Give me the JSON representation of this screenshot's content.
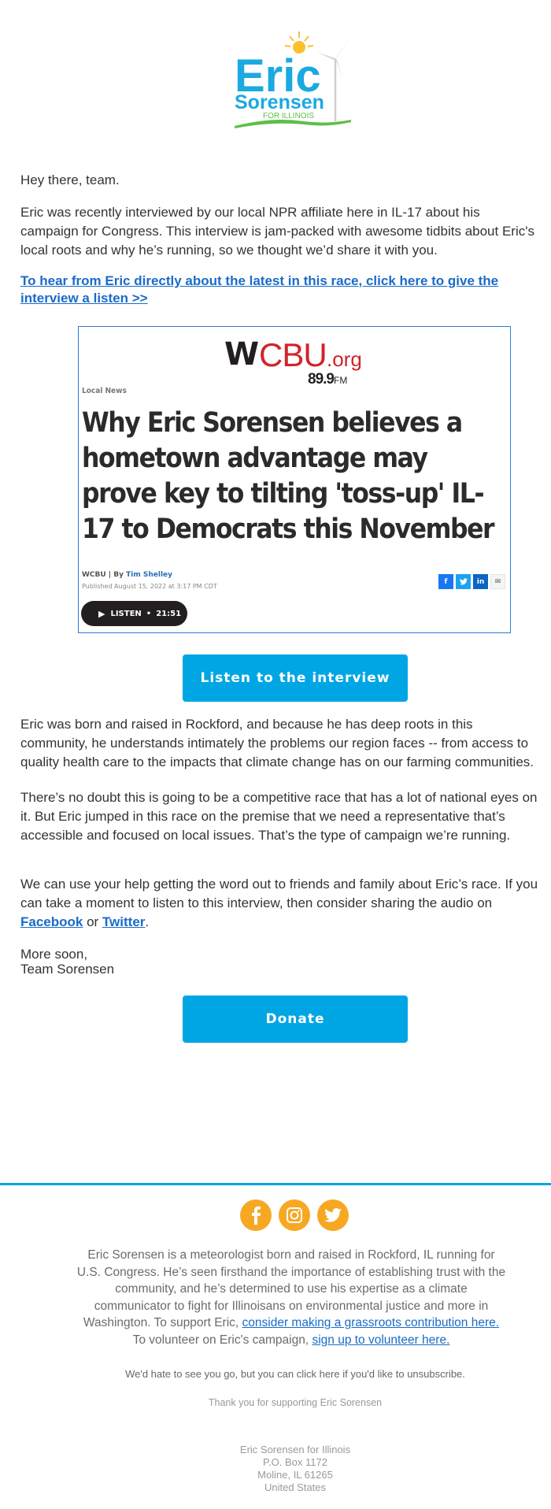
{
  "header": {
    "logo": {
      "name": "Eric",
      "surname": "Sorensen",
      "tagline": "FOR ILLINOIS"
    }
  },
  "body": {
    "greeting": "Hey there, team.",
    "para1_lines": [
      "Eric was recently interviewed by our local NPR affiliate here in IL-17 about his",
      "campaign for Congress. This interview is jam-packed with awesome tidbits about Eric's",
      "local roots and why he’s running, so we thought we’d share it with you."
    ],
    "cta_link": "To hear from Eric directly about the latest in this race, click here to give the interview a listen >> ",
    "news_card": {
      "station_w": "W",
      "station_cbu": "CBU",
      "station_org": ".org",
      "station_freq": "89.9",
      "station_fm": "FM",
      "section": "Local News",
      "headline": "Why Eric Sorensen believes a hometown advantage may prove key to tilting 'toss-up' IL-17 to Democrats this November",
      "byline_prefix": "WCBU | By ",
      "author": "Tim Shelley",
      "published": "Published August 15, 2022 at 3:17 PM CDT",
      "share": {
        "facebook": "f",
        "twitter": "t",
        "linkedin": "in",
        "email": "✉"
      },
      "listen_label": "LISTEN",
      "listen_sep": "•",
      "duration": "21:51"
    },
    "listen_button": "Listen to the interview",
    "para2_lines": [
      "Eric was born and raised in Rockford, and because he has deep roots in this",
      "community, he understands intimately the problems our region faces -- from access to",
      "quality health care to the impacts that climate change has on our farming communities."
    ],
    "para3_lines": [
      "There’s no doubt this is going to be a competitive race that has a lot of national eyes on",
      "it. But Eric jumped in this race on the premise that we need a representative that’s",
      "accessible and focused on local issues. That’s the type of campaign we’re running."
    ],
    "para4_lines": [
      "We can use your help getting the word out to friends and family about Eric’s race. If you",
      "can take a moment to listen to this interview, then consider sharing the audio on"
    ],
    "para4_facebook": "Facebook",
    "para4_or": " or ",
    "para4_twitter": "Twitter",
    "para4_end": ".",
    "closing": "More soon,",
    "signature": "Team Sorensen",
    "donate_button": "Donate"
  },
  "footer": {
    "social": [
      "facebook",
      "instagram",
      "twitter"
    ],
    "bio_lines": [
      "Eric Sorensen is a meteorologist born and raised in Rockford, IL running for",
      "U.S. Congress. He’s seen firsthand the importance of establishing trust with the",
      "community, and he’s determined to use his expertise as a climate",
      "communicator to fight for Illinoisans on environmental justice and more in"
    ],
    "bio_support_prefix": "Washington. To support Eric, ",
    "bio_support_link": "consider making a grassroots contribution here.",
    "bio_volunteer_prefix": "To volunteer on Eric's campaign, ",
    "bio_volunteer_link": "sign up to volunteer here.",
    "unsubscribe": "We'd hate to see you go, but you can click here if you'd like to unsubscribe.",
    "thanks": "Thank you for supporting Eric Sorensen",
    "address": [
      "Eric Sorensen for Illinois",
      "P.O. Box 1172",
      "Moline, IL 61265",
      "United States"
    ]
  },
  "colors": {
    "brand_blue": "#00a6e4",
    "link_blue": "#1a6bc9",
    "social_orange": "#f7a823",
    "logo_green": "#5cbf48",
    "logo_sun": "#fbc02d",
    "wcbu_red": "#d2232a"
  }
}
